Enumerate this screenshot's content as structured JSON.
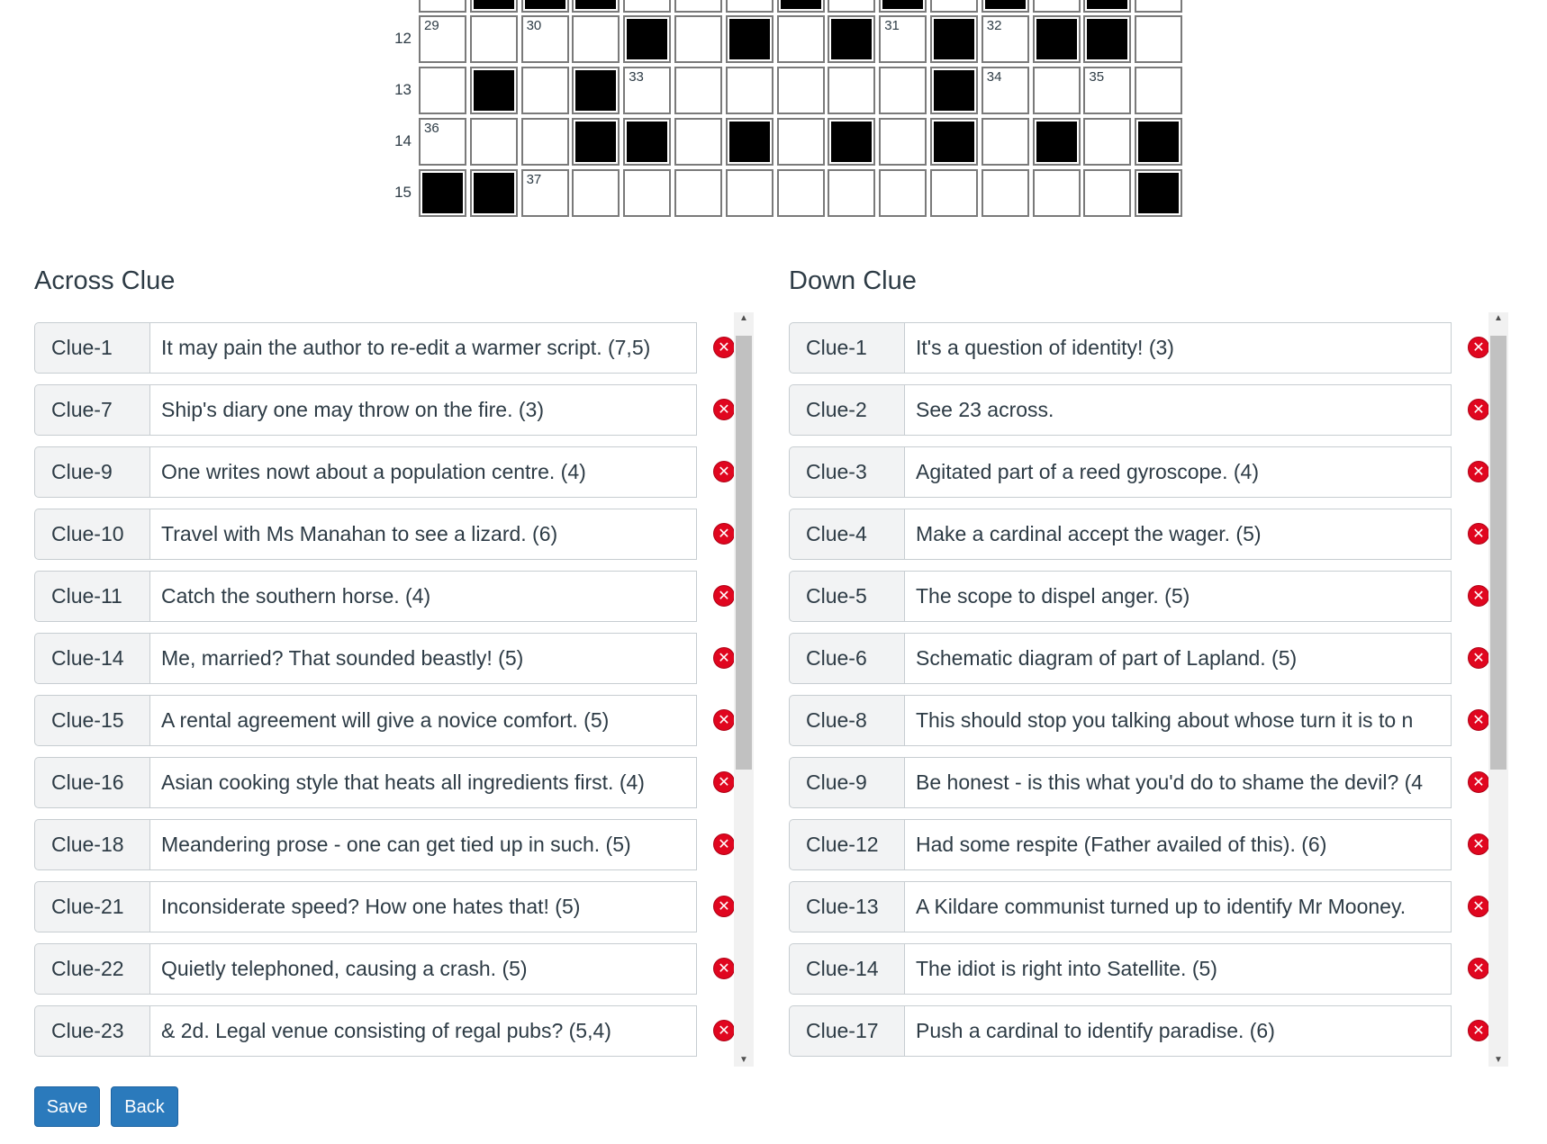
{
  "grid": {
    "row_labels": [
      "12",
      "13",
      "14",
      "15"
    ],
    "top_stub_pattern": [
      0,
      1,
      1,
      1,
      0,
      0,
      0,
      1,
      0,
      1,
      0,
      1,
      0,
      1,
      0
    ],
    "rows": [
      {
        "pattern": [
          0,
          0,
          0,
          0,
          1,
          0,
          1,
          0,
          1,
          0,
          1,
          0,
          1,
          1,
          0
        ],
        "numbers": {
          "0": "29",
          "2": "30",
          "9": "31",
          "11": "32"
        }
      },
      {
        "pattern": [
          0,
          1,
          0,
          1,
          0,
          0,
          0,
          0,
          0,
          0,
          1,
          0,
          0,
          0,
          0
        ],
        "numbers": {
          "4": "33",
          "11": "34",
          "13": "35"
        }
      },
      {
        "pattern": [
          0,
          0,
          0,
          1,
          1,
          0,
          1,
          0,
          1,
          0,
          1,
          0,
          1,
          0,
          1
        ],
        "numbers": {
          "0": "36"
        }
      },
      {
        "pattern": [
          1,
          1,
          0,
          0,
          0,
          0,
          0,
          0,
          0,
          0,
          0,
          0,
          0,
          0,
          1
        ],
        "numbers": {
          "2": "37"
        }
      }
    ]
  },
  "across": {
    "title": "Across Clue",
    "clues": [
      {
        "label": "Clue-1",
        "text": "It may pain the author to re-edit a warmer script. (7,5)"
      },
      {
        "label": "Clue-7",
        "text": "Ship's diary one may throw on the fire. (3)"
      },
      {
        "label": "Clue-9",
        "text": "One writes nowt about a population centre. (4)"
      },
      {
        "label": "Clue-10",
        "text": "Travel with Ms Manahan to see a lizard. (6)"
      },
      {
        "label": "Clue-11",
        "text": "Catch the southern horse. (4)"
      },
      {
        "label": "Clue-14",
        "text": "Me, married? That sounded beastly! (5)"
      },
      {
        "label": "Clue-15",
        "text": "A rental agreement will give a novice comfort. (5)"
      },
      {
        "label": "Clue-16",
        "text": "Asian cooking style that heats all ingredients first. (4)"
      },
      {
        "label": "Clue-18",
        "text": "Meandering prose - one can get tied up in such. (5)"
      },
      {
        "label": "Clue-21",
        "text": "Inconsiderate speed? How one hates that! (5)"
      },
      {
        "label": "Clue-22",
        "text": "Quietly telephoned, causing a crash. (5)"
      },
      {
        "label": "Clue-23",
        "text": "& 2d. Legal venue consisting of regal pubs? (5,4)"
      }
    ]
  },
  "down": {
    "title": "Down Clue",
    "clues": [
      {
        "label": "Clue-1",
        "text": "It's a question of identity! (3)"
      },
      {
        "label": "Clue-2",
        "text": "See 23 across."
      },
      {
        "label": "Clue-3",
        "text": "Agitated part of a reed gyroscope. (4)"
      },
      {
        "label": "Clue-4",
        "text": "Make a cardinal accept the wager. (5)"
      },
      {
        "label": "Clue-5",
        "text": "The scope to dispel anger. (5)"
      },
      {
        "label": "Clue-6",
        "text": "Schematic diagram of part of Lapland. (5)"
      },
      {
        "label": "Clue-8",
        "text": "This should stop you talking about whose turn it is to n"
      },
      {
        "label": "Clue-9",
        "text": "Be honest - is this what you'd do to shame the devil? (4"
      },
      {
        "label": "Clue-12",
        "text": "Had some respite (Father availed of this). (6)"
      },
      {
        "label": "Clue-13",
        "text": "A Kildare communist turned up to identify Mr Mooney."
      },
      {
        "label": "Clue-14",
        "text": "The idiot is right into Satellite. (5)"
      },
      {
        "label": "Clue-17",
        "text": "Push a cardinal to identify paradise. (6)"
      }
    ]
  },
  "delete_icon_glyph": "✕",
  "buttons": {
    "save": "Save",
    "back": "Back"
  },
  "colors": {
    "accent": "#2b7abc",
    "delete": "#e0061f"
  }
}
